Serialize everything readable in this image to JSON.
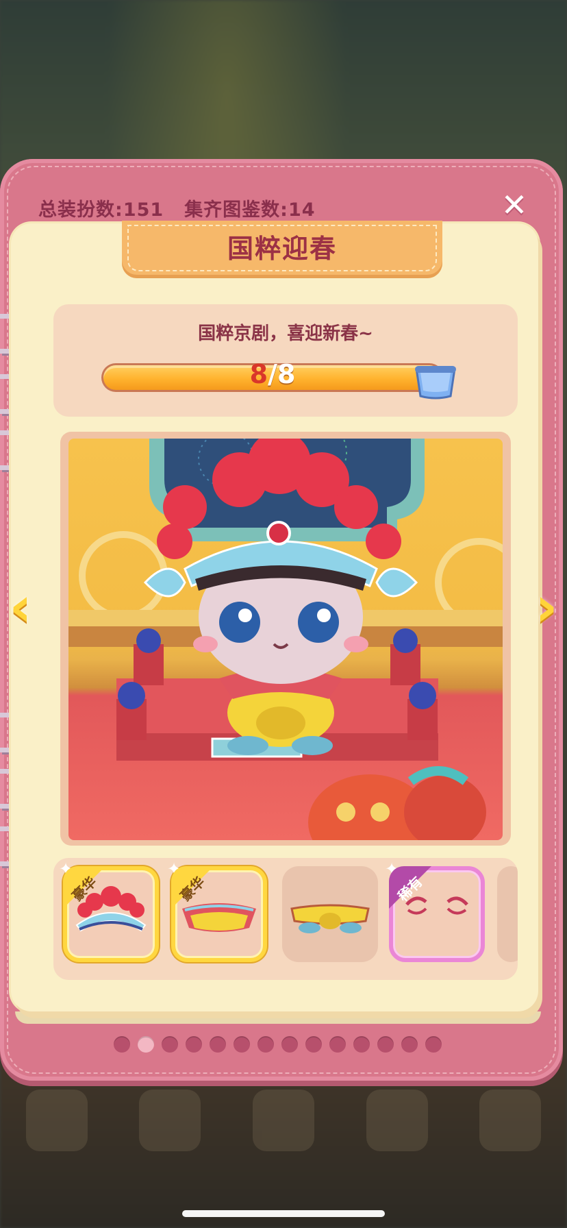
{
  "stats": {
    "total_outfits_label": "总装扮数:",
    "total_outfits_value": "151",
    "collected_label": "集齐图鉴数:",
    "collected_value": "14"
  },
  "close_glyph": "✕",
  "title": "国粹迎春",
  "subtitle": "国粹京剧，喜迎新春~",
  "progress": {
    "current": "8",
    "total": "8",
    "separator": "/",
    "fraction": 1.0
  },
  "nav": {
    "prev_glyph": "‹",
    "next_glyph": "›"
  },
  "items": [
    {
      "tag": "豪华",
      "rarity": "gold",
      "icon": "opera-headdress-icon"
    },
    {
      "tag": "豪华",
      "rarity": "gold",
      "icon": "opera-collar-icon"
    },
    {
      "tag": "",
      "rarity": "none",
      "icon": "opera-belt-icon"
    },
    {
      "tag": "稀有",
      "rarity": "pink",
      "icon": "opera-eyebrows-icon"
    }
  ],
  "pages": {
    "count": 14,
    "active_index": 1
  },
  "colors": {
    "book": "#d9778b",
    "page": "#faf0c8",
    "title_text": "#9c3145",
    "progress_fill": "#ffb32e",
    "deluxe_border": "#ffd740",
    "rare_border": "#ea86d6"
  }
}
